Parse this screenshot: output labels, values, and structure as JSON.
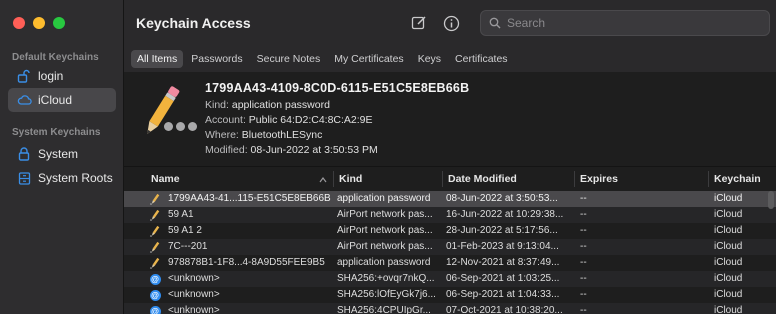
{
  "window": {
    "title": "Keychain Access"
  },
  "colors": {
    "accent": "#2f8cf0",
    "selection": "#48474a",
    "close": "#ff5f57",
    "minimize": "#febc2e",
    "zoom": "#28c840"
  },
  "sidebar": {
    "default_title": "Default Keychains",
    "system_title": "System Keychains",
    "default_items": [
      {
        "label": "login",
        "icon": "unlocked-padlock-icon"
      },
      {
        "label": "iCloud",
        "icon": "cloud-icon"
      }
    ],
    "system_items": [
      {
        "label": "System",
        "icon": "padlock-icon"
      },
      {
        "label": "System Roots",
        "icon": "cabinet-icon"
      }
    ]
  },
  "toolbar": {
    "edit_icon": "compose-icon",
    "info_icon": "info-icon",
    "search_placeholder": "Search"
  },
  "tabs": [
    "All Items",
    "Passwords",
    "Secure Notes",
    "My Certificates",
    "Keys",
    "Certificates"
  ],
  "detail": {
    "title": "1799AA43-4109-8C0D-6115-E51C5E8EB66B",
    "kind_label": "Kind:",
    "kind": "application password",
    "account_label": "Account:",
    "account": "Public 64:D2:C4:8C:A2:9E",
    "where_label": "Where:",
    "where": "BluetoothLESync",
    "modified_label": "Modified:",
    "modified": "08-Jun-2022 at 3:50:53 PM"
  },
  "table": {
    "columns": [
      "Name",
      "Kind",
      "Date Modified",
      "Expires",
      "Keychain"
    ],
    "rows": [
      {
        "name": "1799AA43-41...115-E51C5E8EB66B",
        "kind": "application password",
        "date": "08-Jun-2022 at 3:50:53...",
        "expires": "--",
        "keychain": "iCloud",
        "icon": "key-icon"
      },
      {
        "name": "59 A1",
        "kind": "AirPort network pas...",
        "date": "16-Jun-2022 at 10:29:38...",
        "expires": "--",
        "keychain": "iCloud",
        "icon": "key-icon"
      },
      {
        "name": "59 A1 2",
        "kind": "AirPort network pas...",
        "date": "28-Jun-2022 at 5:17:56...",
        "expires": "--",
        "keychain": "iCloud",
        "icon": "key-icon"
      },
      {
        "name": "7C---201",
        "kind": "AirPort network pas...",
        "date": "01-Feb-2023 at 9:13:04...",
        "expires": "--",
        "keychain": "iCloud",
        "icon": "key-icon"
      },
      {
        "name": "978878B1-1F8...4-8A9D55FEE9B5",
        "kind": "application password",
        "date": "12-Nov-2021 at 8:37:49...",
        "expires": "--",
        "keychain": "iCloud",
        "icon": "key-icon"
      },
      {
        "name": "<unknown>",
        "kind": "SHA256:+ovqr7nkQ...",
        "date": "06-Sep-2021 at 1:03:25...",
        "expires": "--",
        "keychain": "iCloud",
        "icon": "at-sign-icon"
      },
      {
        "name": "<unknown>",
        "kind": "SHA256:lOfEyGk7j6...",
        "date": "06-Sep-2021 at 1:04:33...",
        "expires": "--",
        "keychain": "iCloud",
        "icon": "at-sign-icon"
      },
      {
        "name": "<unknown>",
        "kind": "SHA256:4CPUIpGr...",
        "date": "07-Oct-2021 at 10:38:20...",
        "expires": "--",
        "keychain": "iCloud",
        "icon": "at-sign-icon"
      }
    ]
  }
}
